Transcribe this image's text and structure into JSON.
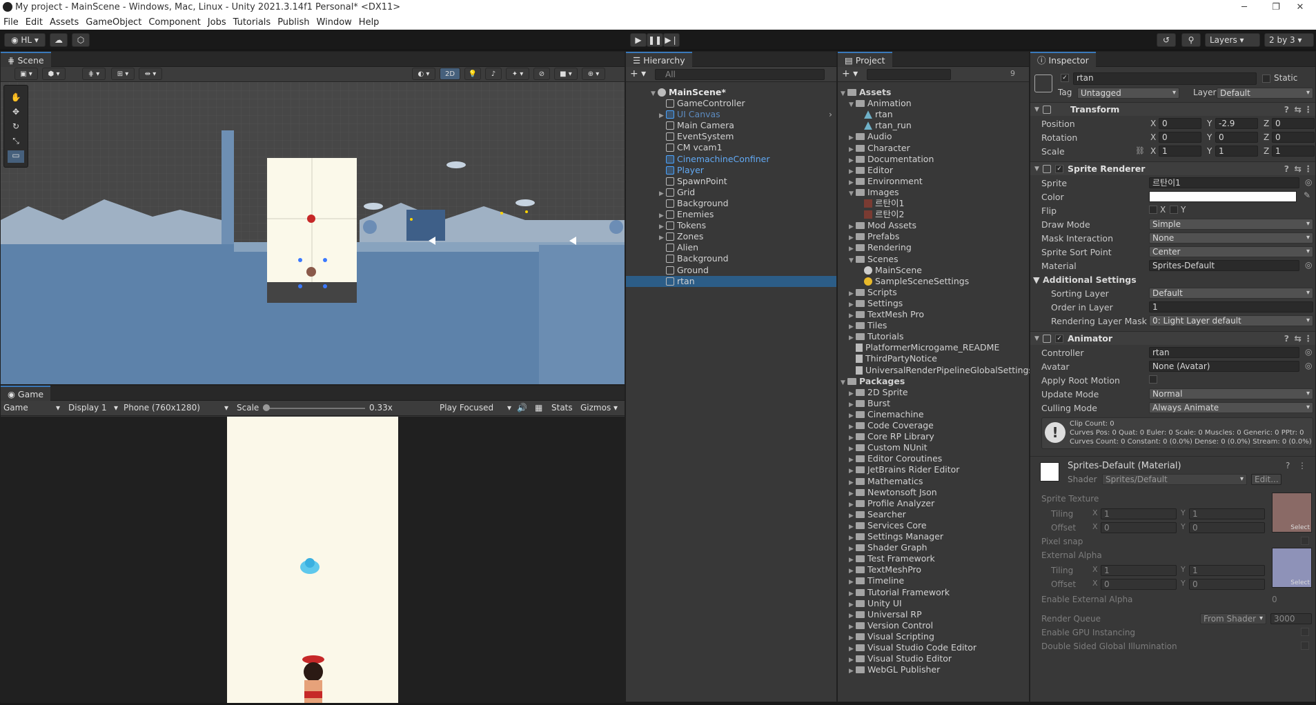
{
  "window": {
    "title": "My project - MainScene - Windows, Mac, Linux - Unity 2021.3.14f1 Personal* <DX11>",
    "min": "─",
    "max": "❐",
    "close": "✕"
  },
  "menu": [
    "File",
    "Edit",
    "Assets",
    "GameObject",
    "Component",
    "Jobs",
    "Tutorials",
    "Publish",
    "Window",
    "Help"
  ],
  "toolbar": {
    "account": "HL",
    "layers": "Layers",
    "layout": "2 by 3"
  },
  "scene": {
    "tab": "Scene",
    "mode2d": "2D"
  },
  "game": {
    "tab": "Game",
    "game_dd": "Game",
    "display": "Display 1",
    "resolution": "Phone (760x1280)",
    "scale_label": "Scale",
    "scale_value": "0.33x",
    "scale_level": 0.02,
    "play_mode": "Play Focused",
    "stats": "Stats",
    "gizmos": "Gizmos"
  },
  "hierarchy": {
    "tab": "Hierarchy",
    "search_placeholder": "All",
    "scene": "MainScene*",
    "items": [
      {
        "label": "GameController",
        "blue": false,
        "arrow": false
      },
      {
        "label": "UI Canvas",
        "blue": true,
        "arrow": true,
        "dim": true
      },
      {
        "label": "Main Camera",
        "blue": false,
        "arrow": false
      },
      {
        "label": "EventSystem",
        "blue": false,
        "arrow": false
      },
      {
        "label": "CM vcam1",
        "blue": false,
        "arrow": false
      },
      {
        "label": "CinemachineConfiner",
        "blue": true,
        "arrow": false
      },
      {
        "label": "Player",
        "blue": true,
        "arrow": false
      },
      {
        "label": "SpawnPoint",
        "blue": false,
        "arrow": false
      },
      {
        "label": "Grid",
        "blue": false,
        "arrow": true
      },
      {
        "label": "Background",
        "blue": false,
        "arrow": false
      },
      {
        "label": "Enemies",
        "blue": false,
        "arrow": true
      },
      {
        "label": "Tokens",
        "blue": false,
        "arrow": true
      },
      {
        "label": "Zones",
        "blue": false,
        "arrow": true
      },
      {
        "label": "Alien",
        "blue": false,
        "arrow": false
      },
      {
        "label": "Background",
        "blue": false,
        "arrow": false
      },
      {
        "label": "Ground",
        "blue": false,
        "arrow": false
      },
      {
        "label": "rtan",
        "blue": false,
        "arrow": false,
        "selected": true
      }
    ]
  },
  "project": {
    "tab": "Project",
    "hidden_count": "9",
    "assets_root": "Assets",
    "items": [
      {
        "label": "Animation",
        "depth": 1,
        "type": "folder",
        "open": true
      },
      {
        "label": "rtan",
        "depth": 2,
        "type": "anim"
      },
      {
        "label": "rtan_run",
        "depth": 2,
        "type": "anim"
      },
      {
        "label": "Audio",
        "depth": 1,
        "type": "folder"
      },
      {
        "label": "Character",
        "depth": 1,
        "type": "folder"
      },
      {
        "label": "Documentation",
        "depth": 1,
        "type": "folder"
      },
      {
        "label": "Editor",
        "depth": 1,
        "type": "folder"
      },
      {
        "label": "Environment",
        "depth": 1,
        "type": "folder"
      },
      {
        "label": "Images",
        "depth": 1,
        "type": "folder",
        "open": true
      },
      {
        "label": "르탄이1",
        "depth": 2,
        "type": "sprite"
      },
      {
        "label": "르탄이2",
        "depth": 2,
        "type": "sprite"
      },
      {
        "label": "Mod Assets",
        "depth": 1,
        "type": "folder"
      },
      {
        "label": "Prefabs",
        "depth": 1,
        "type": "folder"
      },
      {
        "label": "Rendering",
        "depth": 1,
        "type": "folder"
      },
      {
        "label": "Scenes",
        "depth": 1,
        "type": "folder",
        "open": true
      },
      {
        "label": "MainScene",
        "depth": 2,
        "type": "scene"
      },
      {
        "label": "SampleSceneSettings",
        "depth": 2,
        "type": "settings"
      },
      {
        "label": "Scripts",
        "depth": 1,
        "type": "folder"
      },
      {
        "label": "Settings",
        "depth": 1,
        "type": "folder"
      },
      {
        "label": "TextMesh Pro",
        "depth": 1,
        "type": "folder"
      },
      {
        "label": "Tiles",
        "depth": 1,
        "type": "folder"
      },
      {
        "label": "Tutorials",
        "depth": 1,
        "type": "folder"
      },
      {
        "label": "PlatformerMicrogame_README",
        "depth": 1,
        "type": "file"
      },
      {
        "label": "ThirdPartyNotice",
        "depth": 1,
        "type": "file"
      },
      {
        "label": "UniversalRenderPipelineGlobalSettings",
        "depth": 1,
        "type": "file"
      }
    ],
    "packages_root": "Packages",
    "packages": [
      "2D Sprite",
      "Burst",
      "Cinemachine",
      "Code Coverage",
      "Core RP Library",
      "Custom NUnit",
      "Editor Coroutines",
      "JetBrains Rider Editor",
      "Mathematics",
      "Newtonsoft Json",
      "Profile Analyzer",
      "Searcher",
      "Services Core",
      "Settings Manager",
      "Shader Graph",
      "Test Framework",
      "TextMeshPro",
      "Timeline",
      "Tutorial Framework",
      "Unity UI",
      "Universal RP",
      "Version Control",
      "Visual Scripting",
      "Visual Studio Code Editor",
      "Visual Studio Editor",
      "WebGL Publisher"
    ]
  },
  "inspector": {
    "tab": "Inspector",
    "name": "rtan",
    "static": "Static",
    "tag_label": "Tag",
    "tag": "Untagged",
    "layer_label": "Layer",
    "layer": "Default",
    "transform": {
      "title": "Transform",
      "position_label": "Position",
      "position": [
        "0",
        "-2.9",
        "0"
      ],
      "rotation_label": "Rotation",
      "rotation": [
        "0",
        "0",
        "0"
      ],
      "scale_label": "Scale",
      "scale": [
        "1",
        "1",
        "1"
      ]
    },
    "axes": [
      "X",
      "Y",
      "Z"
    ],
    "sprite_renderer": {
      "title": "Sprite Renderer",
      "sprite_label": "Sprite",
      "sprite": "르탄이1",
      "color_label": "Color",
      "color": "#ffffff",
      "flip_label": "Flip",
      "flip_x": "X",
      "flip_y": "Y",
      "draw_mode_label": "Draw Mode",
      "draw_mode": "Simple",
      "mask_label": "Mask Interaction",
      "mask": "None",
      "sort_point_label": "Sprite Sort Point",
      "sort_point": "Center",
      "material_label": "Material",
      "material": "Sprites-Default",
      "additional": "Additional Settings",
      "sorting_layer_label": "Sorting Layer",
      "sorting_layer": "Default",
      "order_label": "Order in Layer",
      "order": "1",
      "mask_layer_label": "Rendering Layer Mask",
      "mask_layer": "0: Light Layer default"
    },
    "animator": {
      "title": "Animator",
      "controller_label": "Controller",
      "controller": "rtan",
      "avatar_label": "Avatar",
      "avatar": "None (Avatar)",
      "root_motion_label": "Apply Root Motion",
      "update_label": "Update Mode",
      "update": "Normal",
      "culling_label": "Culling Mode",
      "culling": "Always Animate",
      "info1": "Clip Count: 0",
      "info2": "Curves Pos: 0 Quat: 0 Euler: 0 Scale: 0 Muscles: 0 Generic: 0 PPtr: 0",
      "info3": "Curves Count: 0 Constant: 0 (0.0%) Dense: 0 (0.0%) Stream: 0 (0.0%)"
    },
    "material": {
      "title": "Sprites-Default (Material)",
      "shader_label": "Shader",
      "shader": "Sprites/Default",
      "edit": "Edit...",
      "sprite_texture": "Sprite Texture",
      "tiling": "Tiling",
      "offset": "Offset",
      "x": "X",
      "y": "Y",
      "tiling1": [
        "1",
        "1"
      ],
      "offset1": [
        "0",
        "0"
      ],
      "select": "Select",
      "pixel_snap": "Pixel snap",
      "external_alpha": "External Alpha",
      "tiling2": [
        "1",
        "1"
      ],
      "offset2": [
        "0",
        "0"
      ],
      "enable_ext_alpha": "Enable External Alpha",
      "enable_ext_alpha_val": "0",
      "render_queue": "Render Queue",
      "render_queue_mode": "From Shader",
      "render_queue_val": "3000",
      "gpu_instancing": "Enable GPU Instancing",
      "double_sided": "Double Sided Global Illumination"
    }
  }
}
